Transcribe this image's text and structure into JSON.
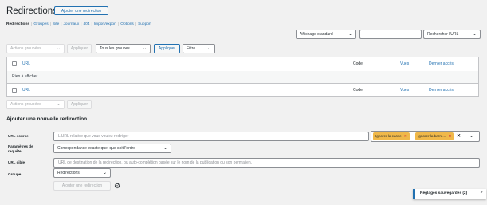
{
  "header": {
    "title": "Redirections",
    "add_button": "Ajouter une redirection"
  },
  "subnav": {
    "items": [
      {
        "label": "Redirections",
        "current": true
      },
      {
        "label": "Groupes"
      },
      {
        "label": "Site"
      },
      {
        "label": "Journaux"
      },
      {
        "label": "404"
      },
      {
        "label": "Import/export"
      },
      {
        "label": "Options"
      },
      {
        "label": "Support"
      }
    ],
    "separator": "|"
  },
  "search": {
    "display_select": "Affichage standard",
    "input_value": "",
    "search_button": "Rechercher l'URL"
  },
  "top_actions": {
    "bulk_select": "Actions groupées",
    "apply_disabled": "Appliquer",
    "groups_select": "Tous les groupes",
    "apply": "Appliquer",
    "filter_select": "Filtre"
  },
  "table": {
    "columns": {
      "url": "URL",
      "code": "Code",
      "hits": "Vues",
      "last": "Dernier accès"
    },
    "empty_message": "Rien à afficher."
  },
  "bottom_actions": {
    "bulk_select": "Actions groupées",
    "apply": "Appliquer"
  },
  "add_form": {
    "heading": "Ajouter une nouvelle redirection",
    "source_label": "URL source",
    "source_placeholder": "L'URL relative que vous voulez rediriger",
    "tags": [
      {
        "label": "Ignorer la casse"
      },
      {
        "label": "Ignorer la barre..."
      }
    ],
    "params_label_1": "Paramètres de",
    "params_label_2": "requête",
    "params_select": "Correspondance exacte quel que soit l'ordre",
    "target_label": "URL cible",
    "target_placeholder": "URL de destination de la redirection, ou auto-complétion basée sur le nom de la publication ou son permalien.",
    "group_label": "Groupe",
    "group_select": "Redirections",
    "submit_button": "Ajouter une redirection"
  },
  "notice": {
    "text": "Réglages sauvegardés (2)"
  },
  "colors": {
    "accent": "#2271b1",
    "tag": "#f0b849",
    "remove": "#d63638"
  }
}
